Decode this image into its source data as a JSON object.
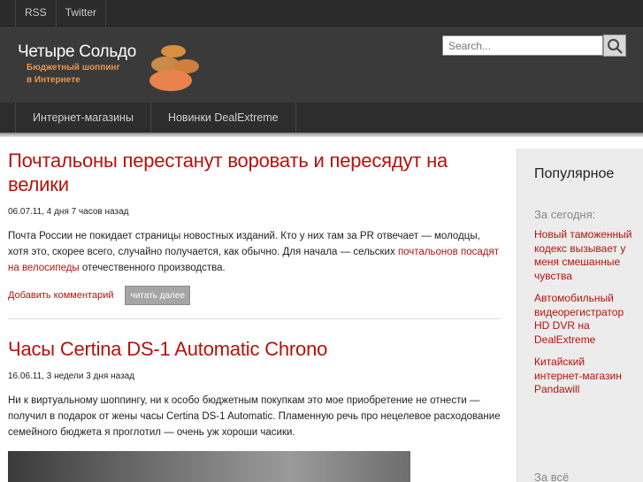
{
  "topnav": {
    "items": [
      "RSS",
      "Twitter"
    ]
  },
  "search": {
    "placeholder": "Search..."
  },
  "header": {
    "title": "Четыре Сольдо",
    "tagline_line1": "Бюджетный шоппинг",
    "tagline_line2": "в Интернете"
  },
  "nav": {
    "items": [
      "Интернет-магазины",
      "Новинки DealExtreme"
    ]
  },
  "posts": [
    {
      "title": "Почтальоны перестанут воровать и пересядут на велики",
      "meta": "06.07.11, 4 дня 7 часов назад",
      "body_before": "Почта России не покидает страницы новостных изданий. Кто у них там за PR отвечает — молодцы, хотя это, скорее всего, случайно получается, как обычно. Для начала — сельских ",
      "body_link": "почтальонов посадят на велосипеды",
      "body_after": " отечественного производства.",
      "comment_label": "Добавить комментарий",
      "more_label": "читать далее"
    },
    {
      "title": "Часы Certina DS-1 Automatic Chrono",
      "meta": "16.06.11, 3 недели 3 дня назад",
      "body": "Ни к виртуальному шоппингу, ни к особо бюджетным покупкам это мое приобретение не отнести — получил в подарок от жены часы Certina DS-1 Automatic. Пламенную речь про нецелевое расходование семейного бюджета я проглотил — очень уж хороши часики."
    }
  ],
  "sidebar": {
    "title": "Популярное",
    "subtitle": "За сегодня:",
    "items": [
      "Новый таможенный кодекс вызывает у меня смешанные чувства",
      "Автомобильный видеорегистратор HD DVR на DealExtreme",
      "Китайский интернет-магазин Pandawill"
    ],
    "bottom": "За всё"
  },
  "colors": {
    "accent": "#b5120b",
    "logo_orange": "#e8964f",
    "header_bg": "#3a3a3a"
  },
  "icons": {
    "search": "search-icon",
    "logo": "coins-logo-icon"
  }
}
